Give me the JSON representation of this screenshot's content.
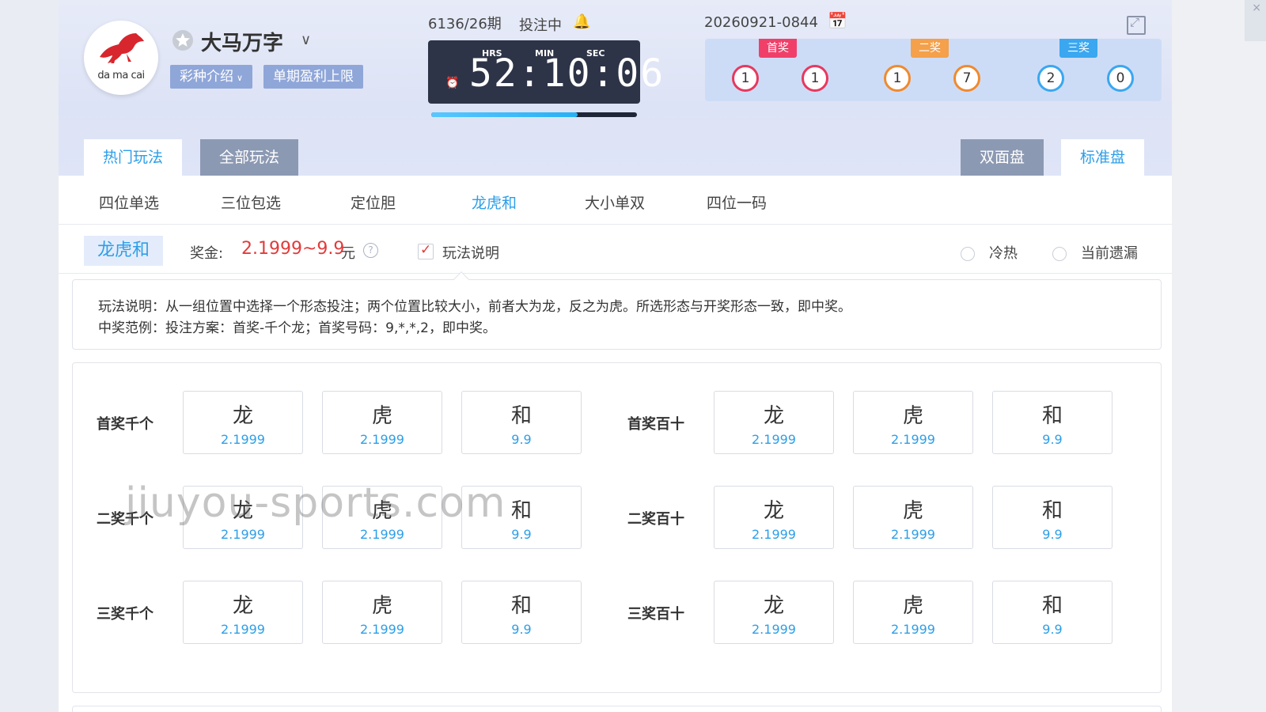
{
  "header": {
    "logo_text": "da ma cai",
    "game_title": "大马万字",
    "intro_button": "彩种介绍",
    "profit_cap_button": "单期盈利上限",
    "period": "6136/26期",
    "bet_status": "投注中",
    "timer": {
      "hrs_label": "HRS",
      "min_label": "MIN",
      "sec_label": "SEC",
      "display": "52:10:06",
      "progress_fraction": 0.71
    },
    "draw_id": "20260921-0844",
    "results": [
      {
        "prize": "首奖",
        "color": "#f0406a",
        "balls": [
          "1",
          "1"
        ],
        "ball_color": "#e8385f"
      },
      {
        "prize": "二奖",
        "color": "#f5a04a",
        "balls": [
          "1",
          "7"
        ],
        "ball_color": "#f08a2e"
      },
      {
        "prize": "三奖",
        "color": "#3aa7f0",
        "balls": [
          "2",
          "0"
        ],
        "ball_color": "#3aa7f0"
      }
    ]
  },
  "tabs": {
    "hot": "热门玩法",
    "all": "全部玩法",
    "double": "双面盘",
    "standard": "标准盘"
  },
  "subtabs": [
    "四位单选",
    "三位包选",
    "定位胆",
    "龙虎和",
    "大小单双",
    "四位一码"
  ],
  "mode": {
    "badge": "龙虎和",
    "prize_label": "奖金:",
    "prize_range": "2.1999~9.9",
    "prize_unit": "元",
    "help_toggle": "玩法说明",
    "cold_hot": "冷热",
    "omission": "当前遗漏"
  },
  "help_text": {
    "line1": "玩法说明：从一组位置中选择一个形态投注；两个位置比较大小，前者大为龙，反之为虎。所选形态与开奖形态一致，即中奖。",
    "line2": "中奖范例：投注方案：首奖-千个龙；首奖号码：9,*,*,2，即中奖。"
  },
  "bet_rows": [
    {
      "label": "首奖千个",
      "options": [
        {
          "name": "龙",
          "odds": "2.1999"
        },
        {
          "name": "虎",
          "odds": "2.1999"
        },
        {
          "name": "和",
          "odds": "9.9"
        }
      ]
    },
    {
      "label": "首奖百十",
      "options": [
        {
          "name": "龙",
          "odds": "2.1999"
        },
        {
          "name": "虎",
          "odds": "2.1999"
        },
        {
          "name": "和",
          "odds": "9.9"
        }
      ]
    },
    {
      "label": "二奖千个",
      "options": [
        {
          "name": "龙",
          "odds": "2.1999"
        },
        {
          "name": "虎",
          "odds": "2.1999"
        },
        {
          "name": "和",
          "odds": "9.9"
        }
      ]
    },
    {
      "label": "二奖百十",
      "options": [
        {
          "name": "龙",
          "odds": "2.1999"
        },
        {
          "name": "虎",
          "odds": "2.1999"
        },
        {
          "name": "和",
          "odds": "9.9"
        }
      ]
    },
    {
      "label": "三奖千个",
      "options": [
        {
          "name": "龙",
          "odds": "2.1999"
        },
        {
          "name": "虎",
          "odds": "2.1999"
        },
        {
          "name": "和",
          "odds": "9.9"
        }
      ]
    },
    {
      "label": "三奖百十",
      "options": [
        {
          "name": "龙",
          "odds": "2.1999"
        },
        {
          "name": "虎",
          "odds": "2.1999"
        },
        {
          "name": "和",
          "odds": "9.9"
        }
      ]
    }
  ],
  "watermark": "jiuyou-sports.com",
  "colors": {
    "accent": "#2d9fe8",
    "prize_red": "#e23b3b",
    "tab_inactive": "#8c99b3"
  }
}
